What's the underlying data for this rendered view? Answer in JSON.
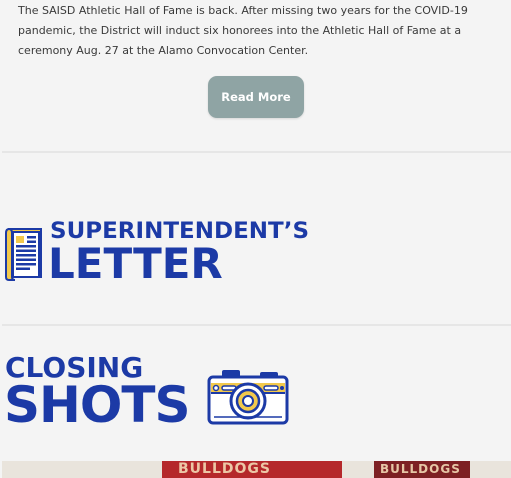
{
  "article": {
    "text": "The SAISD Athletic Hall of Fame is back. After missing two years for the COVID-19 pandemic, the District will induct six honorees into the Athletic Hall of Fame at a ceremony Aug. 27 at the Alamo Convocation Center.",
    "read_more_label": "Read More"
  },
  "superintendent_letter": {
    "line1": "SUPERINTENDENT’S",
    "line2": "LETTER",
    "icon": "letter-document-icon"
  },
  "closing_shots": {
    "line1": "CLOSING",
    "line2": "SHOTS",
    "icon": "camera-icon"
  },
  "photo": {
    "banner_left_text": "BULLDOGS",
    "banner_right_text": "BULLDOGS"
  },
  "colors": {
    "heading_blue": "#1c3aa6",
    "accent_yellow": "#f2c94c",
    "button_bg": "#8fa4a4",
    "background": "#f4f4f4"
  }
}
